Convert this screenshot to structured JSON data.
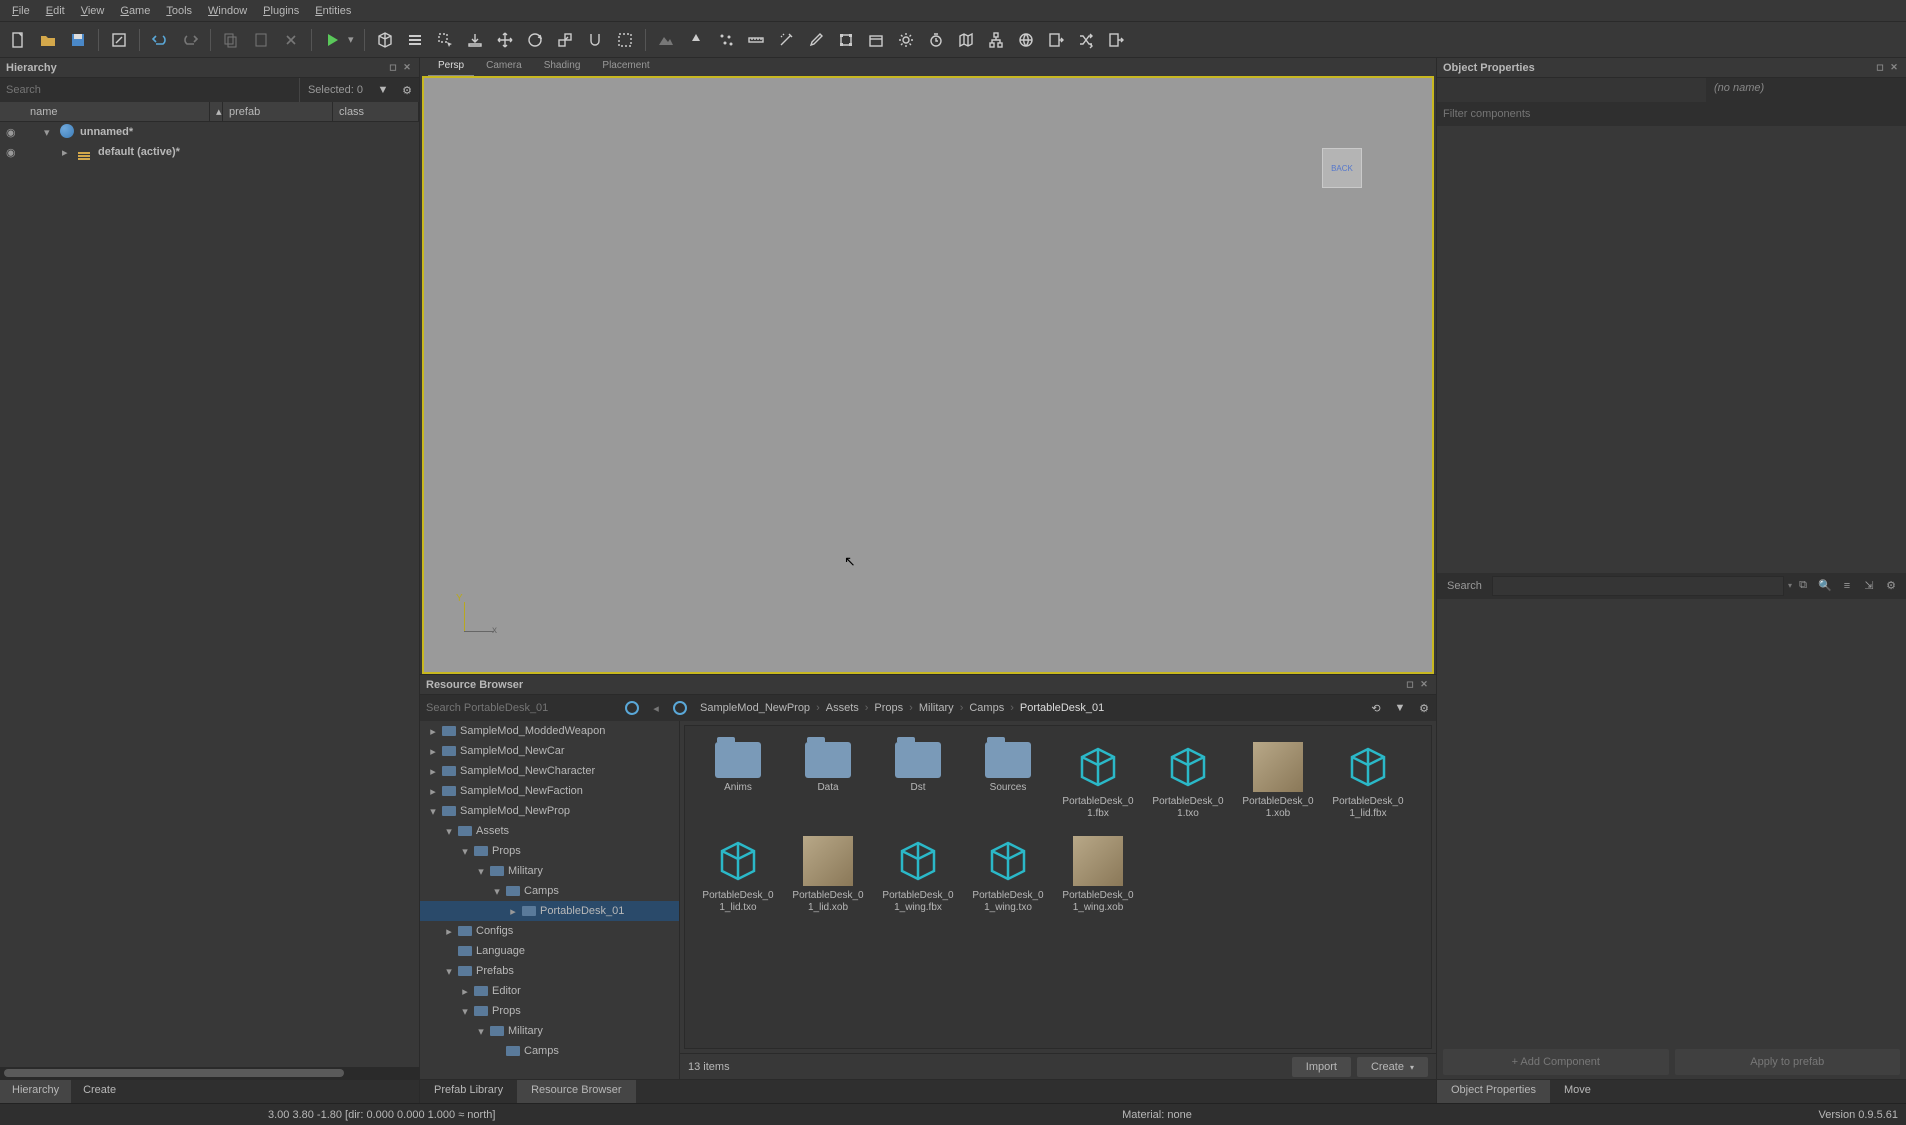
{
  "menu": [
    "File",
    "Edit",
    "View",
    "Game",
    "Tools",
    "Window",
    "Plugins",
    "Entities"
  ],
  "hierarchy": {
    "title": "Hierarchy",
    "search_ph": "Search",
    "selected": "Selected: 0",
    "cols": {
      "name": "name",
      "prefab": "prefab",
      "class": "class"
    },
    "root": "unnamed*",
    "child": "default (active)*",
    "tabs": [
      "Hierarchy",
      "Create"
    ]
  },
  "viewport": {
    "tabs": [
      "Persp",
      "Camera",
      "Shading",
      "Placement"
    ],
    "cube": "BACK"
  },
  "resource": {
    "title": "Resource Browser",
    "search": "Search PortableDesk_01",
    "crumbs": [
      "SampleMod_NewProp",
      "Assets",
      "Props",
      "Military",
      "Camps",
      "PortableDesk_01"
    ],
    "tree": [
      {
        "l": "SampleMod_ModdedWeapon",
        "d": 0,
        "e": false
      },
      {
        "l": "SampleMod_NewCar",
        "d": 0,
        "e": false
      },
      {
        "l": "SampleMod_NewCharacter",
        "d": 0,
        "e": false
      },
      {
        "l": "SampleMod_NewFaction",
        "d": 0,
        "e": false
      },
      {
        "l": "SampleMod_NewProp",
        "d": 0,
        "e": true
      },
      {
        "l": "Assets",
        "d": 1,
        "e": true
      },
      {
        "l": "Props",
        "d": 2,
        "e": true
      },
      {
        "l": "Military",
        "d": 3,
        "e": true
      },
      {
        "l": "Camps",
        "d": 4,
        "e": true
      },
      {
        "l": "PortableDesk_01",
        "d": 5,
        "e": false,
        "sel": true
      },
      {
        "l": "Configs",
        "d": 1,
        "e": false
      },
      {
        "l": "Language",
        "d": 1,
        "e": false,
        "leaf": true
      },
      {
        "l": "Prefabs",
        "d": 1,
        "e": true
      },
      {
        "l": "Editor",
        "d": 2,
        "e": false
      },
      {
        "l": "Props",
        "d": 2,
        "e": true
      },
      {
        "l": "Military",
        "d": 3,
        "e": true
      },
      {
        "l": "Camps",
        "d": 4,
        "e": false,
        "leaf": true
      }
    ],
    "items": [
      {
        "n": "Anims",
        "t": "folder"
      },
      {
        "n": "Data",
        "t": "folder"
      },
      {
        "n": "Dst",
        "t": "folder"
      },
      {
        "n": "Sources",
        "t": "folder"
      },
      {
        "n": "PortableDesk_01.fbx",
        "t": "cube"
      },
      {
        "n": "PortableDesk_01.txo",
        "t": "cube"
      },
      {
        "n": "PortableDesk_01.xob",
        "t": "img"
      },
      {
        "n": "PortableDesk_01_lid.fbx",
        "t": "cube"
      },
      {
        "n": "PortableDesk_01_lid.txo",
        "t": "cube"
      },
      {
        "n": "PortableDesk_01_lid.xob",
        "t": "img"
      },
      {
        "n": "PortableDesk_01_wing.fbx",
        "t": "cube"
      },
      {
        "n": "PortableDesk_01_wing.txo",
        "t": "cube"
      },
      {
        "n": "PortableDesk_01_wing.xob",
        "t": "img"
      }
    ],
    "count": "13 items",
    "import": "Import",
    "create": "Create",
    "tabs": [
      "Prefab Library",
      "Resource Browser"
    ]
  },
  "props": {
    "title": "Object Properties",
    "noname": "(no name)",
    "filter_ph": "Filter components",
    "search": "Search",
    "add": "+ Add Component",
    "apply": "Apply to prefab",
    "tabs": [
      "Object Properties",
      "Move"
    ]
  },
  "status": {
    "coords": "3.00    3.80    -1.80 [dir: 0.000  0.000  1.000 ≈ north]",
    "material": "Material: none",
    "version": "Version 0.9.5.61"
  }
}
